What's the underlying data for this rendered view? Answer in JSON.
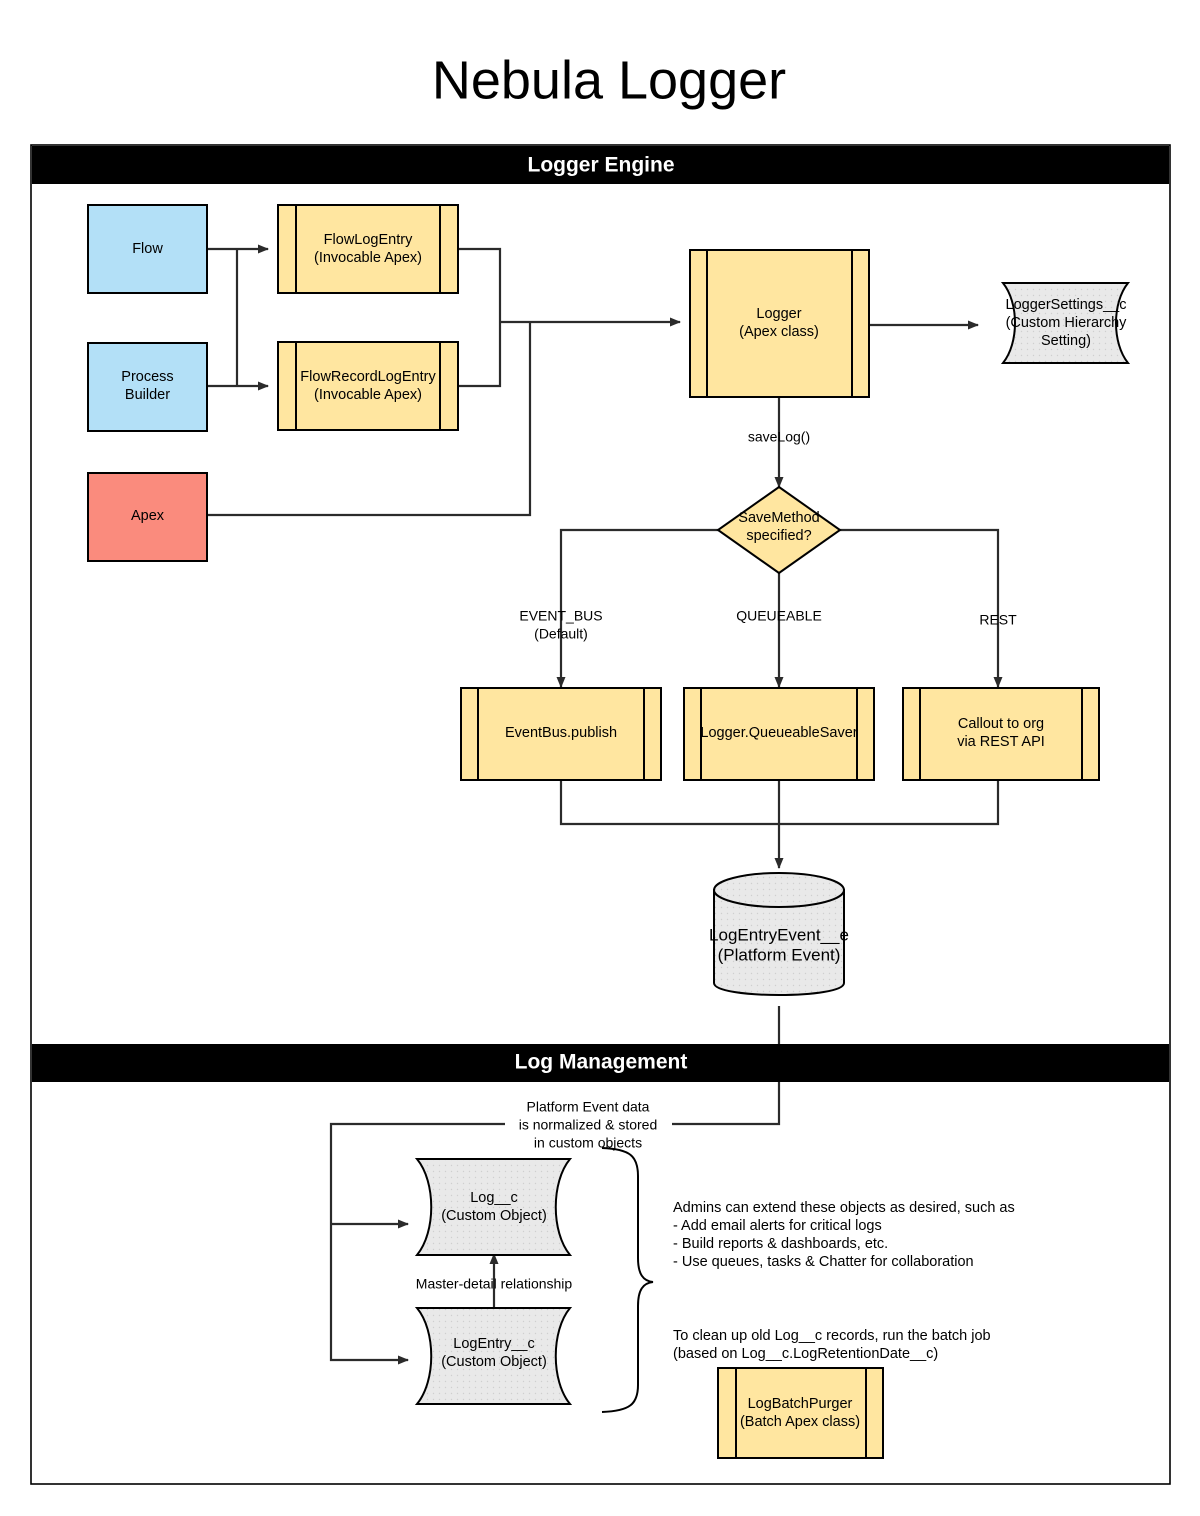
{
  "page": {
    "title": "Nebula Logger",
    "accent_yellow": "#ffe6a0",
    "accent_blue": "#b3e0f7",
    "accent_red": "#fa8b7d",
    "accent_grey": "#e8e8e8",
    "banner_bg": "#000000",
    "banner_fg": "#ffffff"
  },
  "sections": {
    "logger_engine": {
      "banner": "Logger Engine"
    },
    "log_management": {
      "banner": "Log Management"
    }
  },
  "nodes": {
    "flow": {
      "label": "Flow",
      "shape": "rect",
      "color": "#b3e0f7"
    },
    "process_builder": {
      "line1": "Process",
      "line2": "Builder",
      "shape": "rect",
      "color": "#b3e0f7"
    },
    "apex": {
      "label": "Apex",
      "shape": "rect",
      "color": "#fa8b7d"
    },
    "flow_log_entry": {
      "line1": "FlowLogEntry",
      "line2": "(Invocable  Apex)",
      "shape": "module",
      "color": "#ffe6a0"
    },
    "flow_record_log_entry": {
      "line1": "FlowRecordLogEntry",
      "line2": "(Invocable Apex)",
      "shape": "module",
      "color": "#ffe6a0"
    },
    "logger": {
      "line1": "Logger",
      "line2": "(Apex class)",
      "shape": "module",
      "color": "#ffe6a0"
    },
    "logger_settings": {
      "line1": "LoggerSettings__c",
      "line2": "(Custom Hierarchy",
      "line3": "Setting)",
      "shape": "h-cylinder",
      "color": "#e8e8e8"
    },
    "save_method_decision": {
      "line1": "SaveMethod",
      "line2": "specified?",
      "shape": "diamond",
      "color": "#ffe6a0"
    },
    "event_bus_publish": {
      "label": "EventBus.publish",
      "shape": "module",
      "color": "#ffe6a0"
    },
    "queueable_saver": {
      "label": "Logger.QueueableSaver",
      "shape": "module",
      "color": "#ffe6a0"
    },
    "rest_callout": {
      "line1": "Callout to org",
      "line2": "via REST API",
      "shape": "module",
      "color": "#ffe6a0"
    },
    "log_entry_event": {
      "line1": "LogEntryEvent__e",
      "line2": "(Platform Event)",
      "shape": "v-cylinder",
      "color": "#e8e8e8"
    },
    "log_object": {
      "line1": "Log__c",
      "line2": "(Custom Object)",
      "shape": "h-cylinder",
      "color": "#e8e8e8"
    },
    "log_entry_object": {
      "line1": "LogEntry__c",
      "line2": "(Custom Object)",
      "shape": "h-cylinder",
      "color": "#e8e8e8"
    },
    "log_batch_purger": {
      "line1": "LogBatchPurger",
      "line2": "(Batch Apex class)",
      "shape": "module",
      "color": "#ffe6a0"
    }
  },
  "edge_labels": {
    "save_log": "saveLog()",
    "event_bus": {
      "line1": "EVENT_BUS",
      "line2": "(Default)"
    },
    "queueable": "QUEUEABLE",
    "rest": "REST",
    "platform_event_note": {
      "line1": "Platform Event data",
      "line2": "is normalized & stored",
      "line3": "in custom objects"
    },
    "master_detail": "Master-detail relationship"
  },
  "notes": {
    "admin_note": [
      "Admins can extend these objects as desired, such as",
      "  - Add email alerts for critical logs",
      "  - Build reports & dashboards, etc.",
      "  - Use queues, tasks & Chatter for collaboration"
    ],
    "purge_note": [
      "To clean up old Log__c records, run the batch job",
      "(based on Log__c.LogRetentionDate__c)"
    ]
  }
}
